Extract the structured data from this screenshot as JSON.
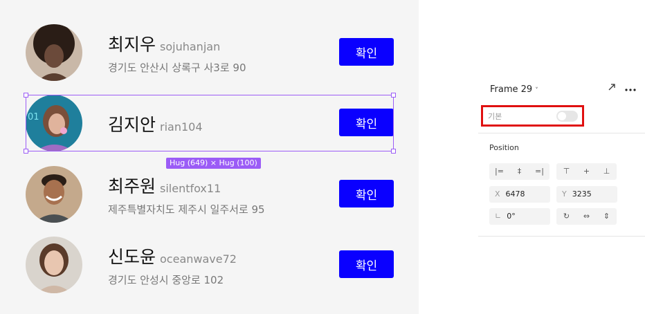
{
  "users": [
    {
      "name": "최지우",
      "username": "sojuhanjan",
      "address": "경기도 안산시 상록구 사3로 90",
      "button": "확인",
      "avatar_color": "#6b4a3a"
    },
    {
      "name": "김지안",
      "username": "rian104",
      "address": "",
      "button": "확인",
      "avatar_color": "#2a6f86"
    },
    {
      "name": "최주원",
      "username": "silentfox11",
      "address": "제주특별자치도 제주시 일주서로 95",
      "button": "확인",
      "avatar_color": "#7a5a3e"
    },
    {
      "name": "신도윤",
      "username": "oceanwave72",
      "address": "경기도 안성시 중앙로 102",
      "button": "확인",
      "avatar_color": "#b89a86"
    }
  ],
  "selection": {
    "hug_label": "Hug (649) × Hug (100)",
    "color": "#9b5cf6"
  },
  "panel": {
    "frame_title": "Frame 29",
    "caret": "˅",
    "style_label": "기본",
    "style_toggle_on": false,
    "position_title": "Position",
    "align_icons": [
      "align-left-icon",
      "align-center-h-icon",
      "align-right-icon",
      "align-top-icon",
      "align-center-v-icon",
      "align-bottom-icon"
    ],
    "x_label": "X",
    "x_value": "6478",
    "y_label": "Y",
    "y_value": "3235",
    "rotation_label": "∟",
    "rotation_value": "0°"
  },
  "colors": {
    "accent_button": "#0a00ff",
    "highlight": "#e01010",
    "canvas_bg": "#f5f5f5"
  }
}
